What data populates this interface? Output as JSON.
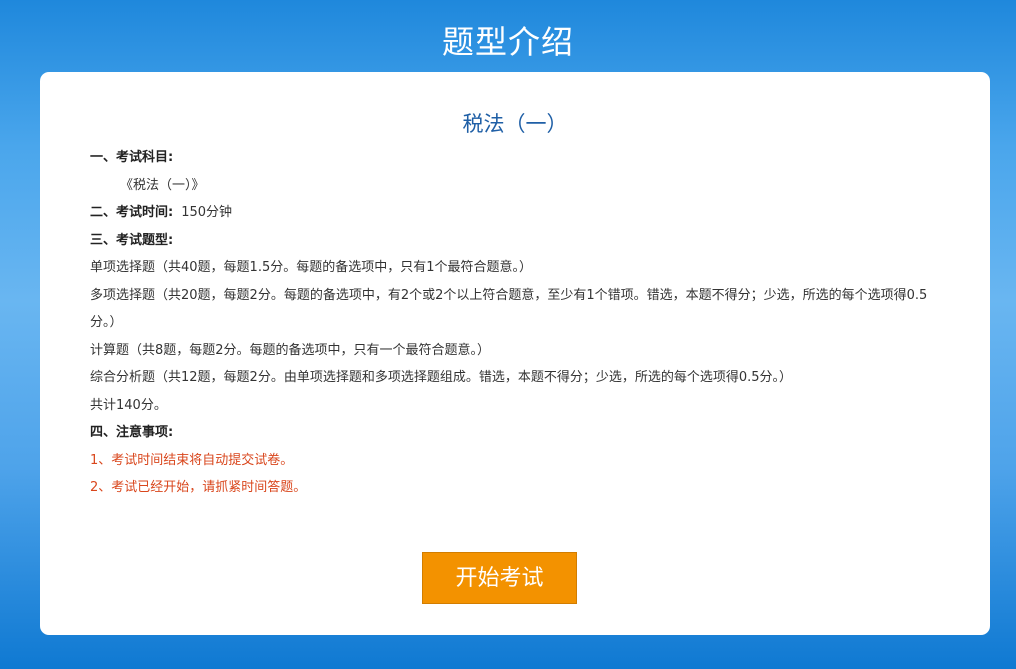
{
  "page": {
    "title": "题型介绍"
  },
  "card": {
    "subject": "税法（一）",
    "sections": {
      "exam_subject_label": "一、考试科目:",
      "exam_subject_value": "《税法（一）》",
      "exam_time_label": "二、考试时间:",
      "exam_time_value": "150分钟",
      "question_types_label": "三、考试题型:",
      "question_types": [
        "单项选择题（共40题，每题1.5分。每题的备选项中，只有1个最符合题意。）",
        "多项选择题（共20题，每题2分。每题的备选项中，有2个或2个以上符合题意，至少有1个错项。错选，本题不得分；少选，所选的每个选项得0.5分。）",
        "计算题（共8题，每题2分。每题的备选项中，只有一个最符合题意。）",
        "综合分析题（共12题，每题2分。由单项选择题和多项选择题组成。错选，本题不得分；少选，所选的每个选项得0.5分。）"
      ],
      "total": "共计140分。",
      "notes_label": "四、注意事项:",
      "notes": [
        "1、考试时间结束将自动提交试卷。",
        "2、考试已经开始，请抓紧时间答题。"
      ]
    },
    "start_button_label": "开始考试"
  },
  "colors": {
    "background_blue": "#4aa6ec",
    "subject_title": "#1f5fa6",
    "notes_red": "#d9461c",
    "button_orange": "#f39200"
  }
}
